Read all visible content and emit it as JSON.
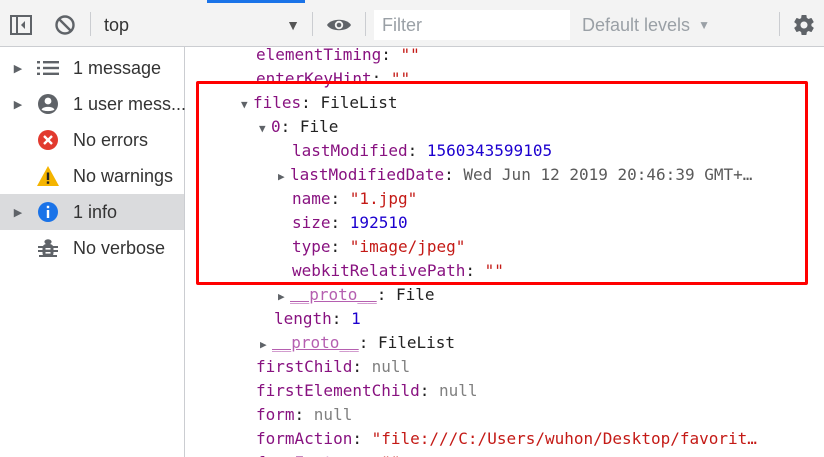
{
  "toolbar": {
    "context": "top",
    "filter_placeholder": "Filter",
    "levels_label": "Default levels"
  },
  "sidebar": {
    "items": [
      {
        "label": "1 message",
        "icon": "list-icon"
      },
      {
        "label": "1 user mess...",
        "icon": "user-icon"
      },
      {
        "label": "No errors",
        "icon": "error-icon"
      },
      {
        "label": "No warnings",
        "icon": "warning-icon"
      },
      {
        "label": "1 info",
        "icon": "info-icon"
      },
      {
        "label": "No verbose",
        "icon": "bug-icon"
      }
    ]
  },
  "console": {
    "elementTiming": {
      "key": "elementTiming",
      "value": "\"\""
    },
    "enterKeyHint": {
      "key": "enterKeyHint",
      "value": "\"\""
    },
    "files": {
      "key": "files",
      "value": "FileList"
    },
    "file0": {
      "key": "0",
      "value": "File"
    },
    "lastModified": {
      "key": "lastModified",
      "value": "1560343599105"
    },
    "lastModifiedDate": {
      "key": "lastModifiedDate",
      "value": "Wed Jun 12 2019 20:46:39 GMT+…"
    },
    "name": {
      "key": "name",
      "value": "\"1.jpg\""
    },
    "size": {
      "key": "size",
      "value": "192510"
    },
    "type": {
      "key": "type",
      "value": "\"image/jpeg\""
    },
    "webkitRelativePath": {
      "key": "webkitRelativePath",
      "value": "\"\""
    },
    "proto_file": {
      "key": "__proto__",
      "value": "File"
    },
    "length": {
      "key": "length",
      "value": "1"
    },
    "proto_filelist": {
      "key": "__proto__",
      "value": "FileList"
    },
    "firstChild": {
      "key": "firstChild",
      "value": "null"
    },
    "firstElementChild": {
      "key": "firstElementChild",
      "value": "null"
    },
    "form": {
      "key": "form",
      "value": "null"
    },
    "formAction": {
      "key": "formAction",
      "value": "\"file:///C:/Users/wuhon/Desktop/favorit…"
    },
    "formEnctype": {
      "key": "formEnctype",
      "value": "\"\""
    }
  },
  "colors": {
    "highlight_border": "#ff0000",
    "property_key": "#881280",
    "string_value": "#c41a16",
    "number_value": "#1c00cf",
    "null_value": "#808080",
    "selected_item_bg": "#dadbdd",
    "error_red": "#e23a2f",
    "warning_yellow": "#f4b400",
    "info_blue": "#1a73e8"
  }
}
